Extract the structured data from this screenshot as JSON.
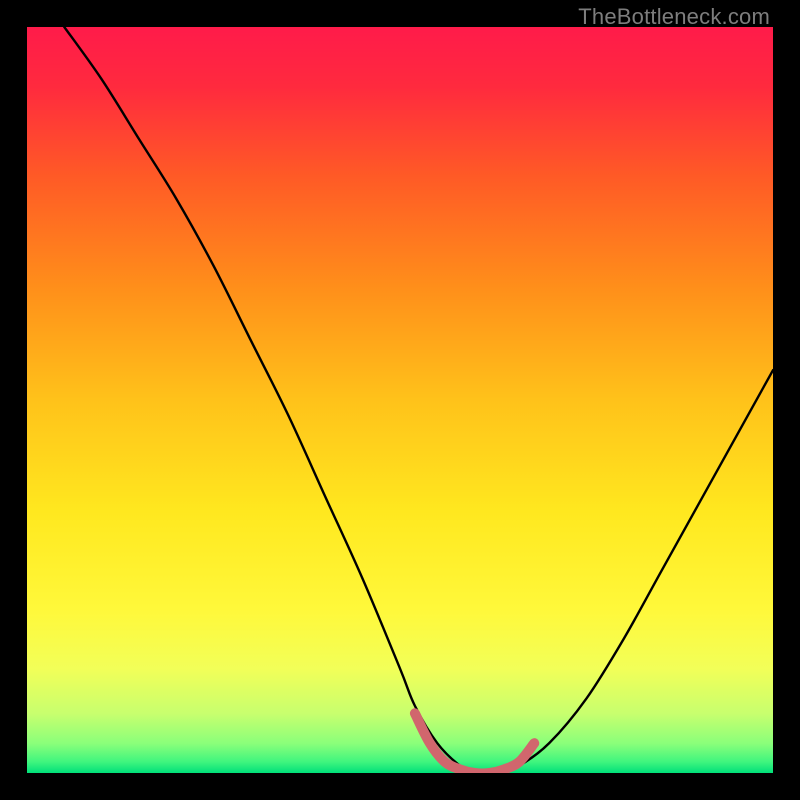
{
  "watermark": {
    "text": "TheBottleneck.com"
  },
  "chart_data": {
    "type": "line",
    "title": "",
    "xlabel": "",
    "ylabel": "",
    "xlim": [
      0,
      100
    ],
    "ylim": [
      0,
      100
    ],
    "grid": false,
    "legend": false,
    "gradient_stops": [
      {
        "offset": 0.0,
        "color": "#ff1b4a"
      },
      {
        "offset": 0.08,
        "color": "#ff2a3e"
      },
      {
        "offset": 0.2,
        "color": "#ff5a26"
      },
      {
        "offset": 0.35,
        "color": "#ff8f1a"
      },
      {
        "offset": 0.5,
        "color": "#ffc21a"
      },
      {
        "offset": 0.65,
        "color": "#ffe81f"
      },
      {
        "offset": 0.78,
        "color": "#fff83a"
      },
      {
        "offset": 0.86,
        "color": "#f2ff58"
      },
      {
        "offset": 0.92,
        "color": "#c8ff6e"
      },
      {
        "offset": 0.96,
        "color": "#8bff7a"
      },
      {
        "offset": 0.985,
        "color": "#40f57e"
      },
      {
        "offset": 1.0,
        "color": "#00e07a"
      }
    ],
    "series": [
      {
        "name": "bottleneck-curve",
        "color": "#000000",
        "x": [
          5,
          10,
          15,
          20,
          25,
          30,
          35,
          40,
          45,
          50,
          52,
          55,
          58,
          60,
          63,
          66,
          70,
          75,
          80,
          85,
          90,
          95,
          100
        ],
        "y": [
          100,
          93,
          85,
          77,
          68,
          58,
          48,
          37,
          26,
          14,
          9,
          4,
          1,
          0,
          0,
          1,
          4,
          10,
          18,
          27,
          36,
          45,
          54
        ]
      },
      {
        "name": "sweet-spot-marker",
        "color": "#d1666d",
        "x": [
          52,
          54,
          56,
          58,
          60,
          62,
          64,
          66,
          68
        ],
        "y": [
          8,
          4,
          1.5,
          0.5,
          0,
          0,
          0.5,
          1.5,
          4
        ]
      }
    ]
  }
}
